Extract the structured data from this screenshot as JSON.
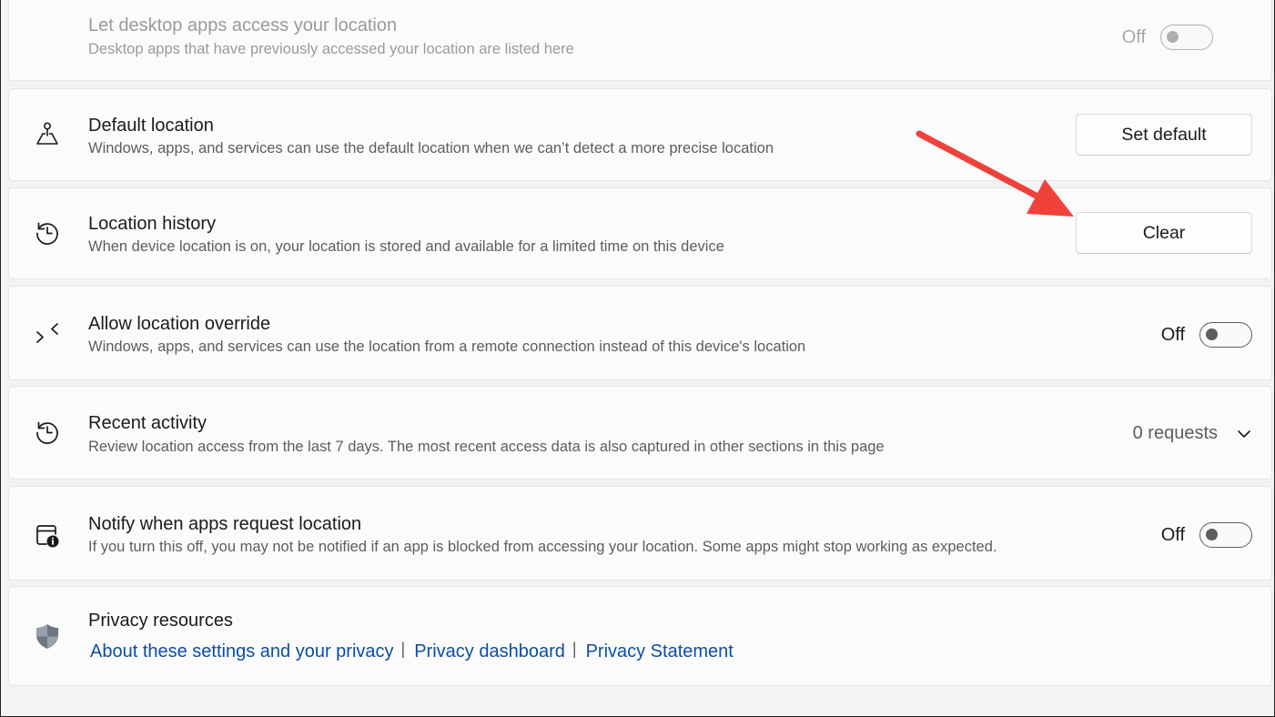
{
  "rows": {
    "desktop_apps": {
      "title": "Let desktop apps access your location",
      "desc": "Desktop apps that have previously accessed your location are listed here",
      "toggle_label": "Off"
    },
    "default_location": {
      "title": "Default location",
      "desc": "Windows, apps, and services can use the default location when we can’t detect a more precise location",
      "button_label": "Set default"
    },
    "location_history": {
      "title": "Location history",
      "desc": "When device location is on, your location is stored and available for a limited time on this device",
      "button_label": "Clear"
    },
    "override": {
      "title": "Allow location override",
      "desc": "Windows, apps, and services can use the location from a remote connection instead of this device's location",
      "toggle_label": "Off"
    },
    "recent_activity": {
      "title": "Recent activity",
      "desc": "Review location access from the last 7 days. The most recent access data is also captured in other sections in this page",
      "dropdown_value": "0 requests"
    },
    "notify": {
      "title": "Notify when apps request location",
      "desc": "If you turn this off, you may not be notified if an app is blocked from accessing your location. Some apps might stop working as expected.",
      "toggle_label": "Off"
    },
    "privacy": {
      "title": "Privacy resources",
      "links": [
        "About these settings and your privacy",
        "Privacy dashboard",
        "Privacy Statement"
      ]
    }
  },
  "icons": {
    "default_location": "map-pin-stand-icon",
    "location_history": "history-clock-icon",
    "override": "location-override-icon",
    "recent_activity": "history-clock-icon",
    "notify": "calendar-info-icon",
    "privacy": "shield-icon",
    "annotation": "red-arrow-icon"
  },
  "colors": {
    "accent_link": "#0a4ea3",
    "annotation_arrow": "#f0423a"
  }
}
